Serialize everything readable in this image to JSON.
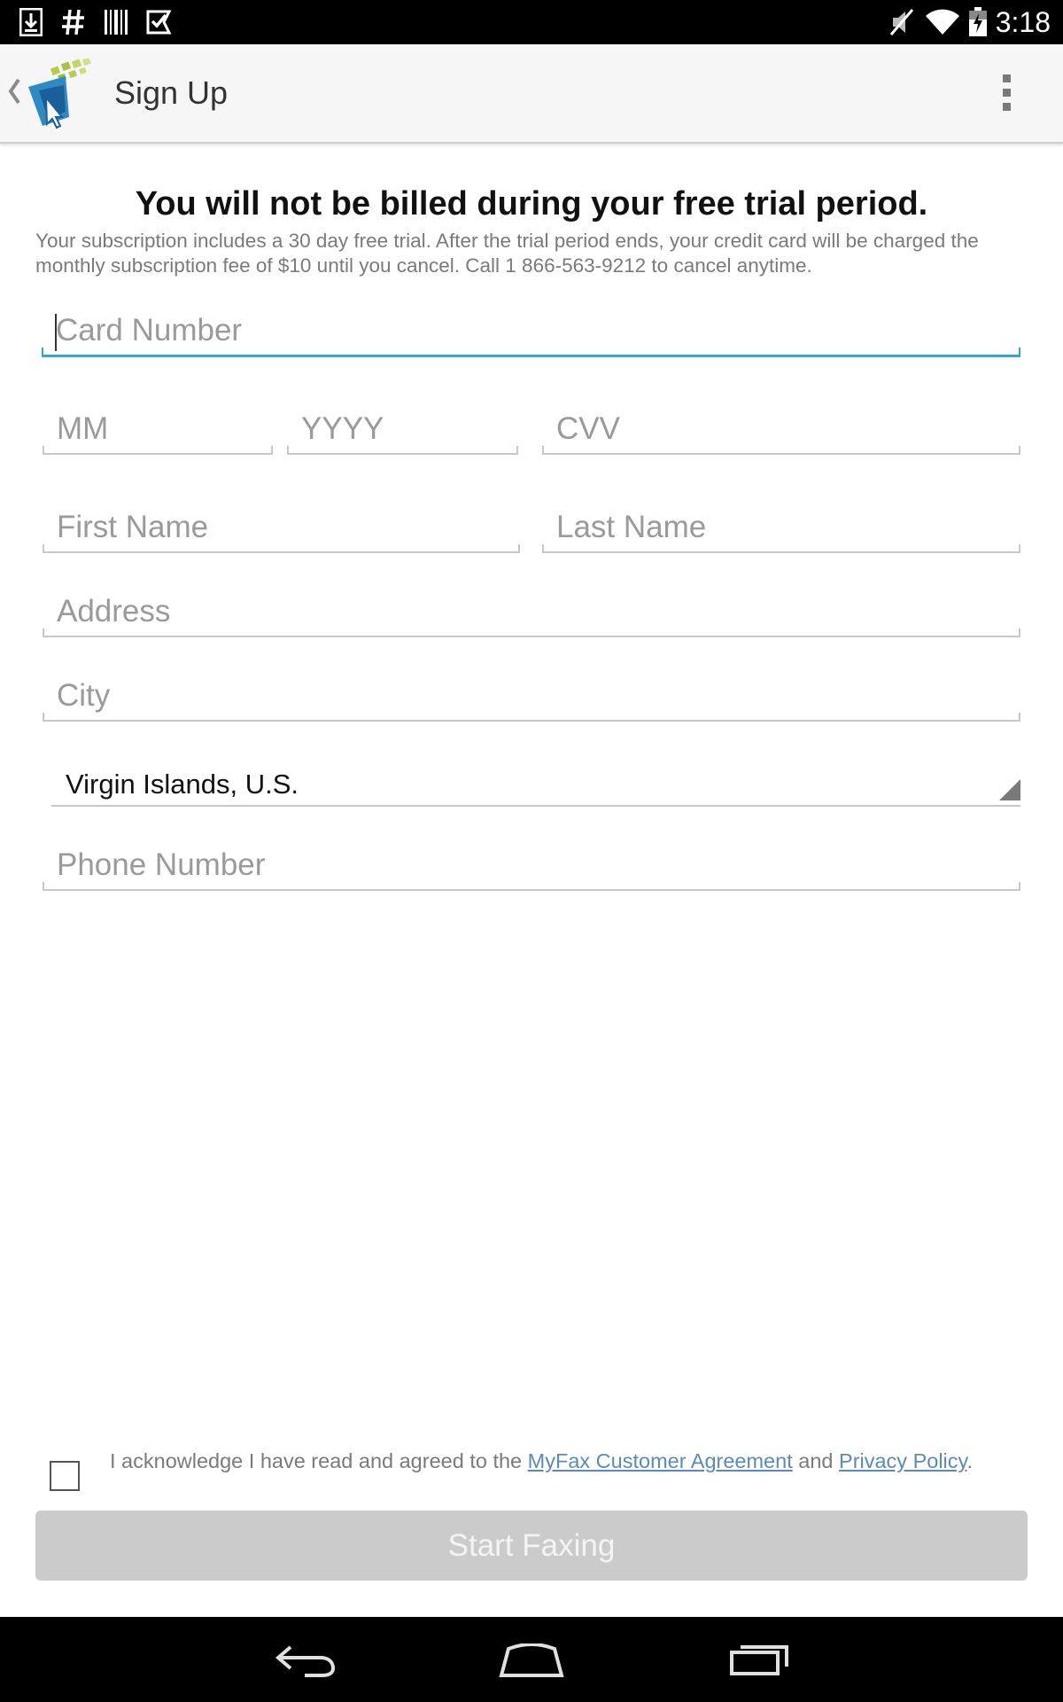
{
  "status_bar": {
    "time": "3:18",
    "left_icons": [
      "download-icon",
      "hash-icon",
      "barcode-icon",
      "check-ticket-icon"
    ],
    "right_icons": [
      "mute-icon",
      "wifi-icon",
      "battery-icon"
    ]
  },
  "action_bar": {
    "title": "Sign Up",
    "icons": [
      "back-caret-icon",
      "myfax-logo-icon",
      "overflow-menu-icon"
    ]
  },
  "notice": {
    "heading": "You will not be billed during your free trial period.",
    "body": "Your subscription includes a 30 day free trial. After the trial period ends, your credit card will be charged the monthly subscription fee of $10 until you cancel. Call 1 866-563-9212 to cancel anytime."
  },
  "form": {
    "card_number": {
      "placeholder": "Card Number",
      "value": ""
    },
    "month": {
      "placeholder": "MM",
      "value": ""
    },
    "year": {
      "placeholder": "YYYY",
      "value": ""
    },
    "cvv": {
      "placeholder": "CVV",
      "value": ""
    },
    "first_name": {
      "placeholder": "First Name",
      "value": ""
    },
    "last_name": {
      "placeholder": "Last Name",
      "value": ""
    },
    "address": {
      "placeholder": "Address",
      "value": ""
    },
    "city": {
      "placeholder": "City",
      "value": ""
    },
    "country": {
      "selected": "Virgin Islands, U.S."
    },
    "phone": {
      "placeholder": "Phone Number",
      "value": ""
    }
  },
  "agreement": {
    "checked": false,
    "prefix": "I acknowledge I have read and agreed to the ",
    "link1": "MyFax Customer Agreement",
    "middle": " and ",
    "link2": "Privacy Policy",
    "suffix": "."
  },
  "submit": {
    "label": "Start Faxing",
    "enabled": false
  },
  "nav_bar": {
    "icons": [
      "back-icon",
      "home-icon",
      "recents-icon"
    ]
  },
  "colors": {
    "accent": "#33a5d2",
    "link": "#5a8bb8",
    "button_disabled": "#cbcbcb"
  }
}
